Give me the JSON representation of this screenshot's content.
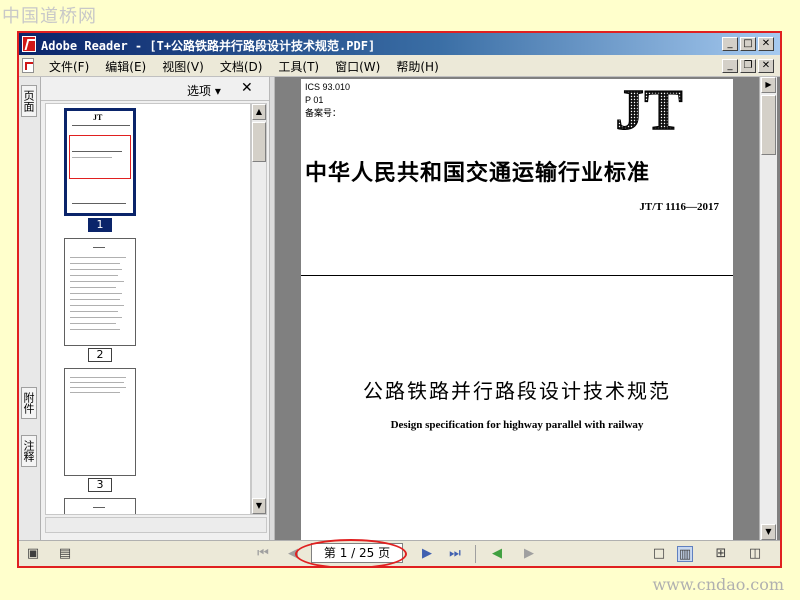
{
  "watermark": {
    "top": "中国道桥网",
    "bottom": "www.cndao.com"
  },
  "window": {
    "title": "Adobe Reader - [T+公路铁路并行路段设计技术规范.PDF]",
    "controls": {
      "minimize": "_",
      "maximize": "□",
      "close": "✕"
    },
    "doc_controls": {
      "minimize": "_",
      "restore": "❐",
      "close": "✕"
    }
  },
  "menu": [
    "文件(F)",
    "编辑(E)",
    "视图(V)",
    "文档(D)",
    "工具(T)",
    "窗口(W)",
    "帮助(H)"
  ],
  "tabs": {
    "pages": "页面",
    "attachments": "附件",
    "comments": "注释"
  },
  "panel": {
    "options_label": "选项 ▾",
    "close": "✕",
    "thumbnails": [
      {
        "num": "1",
        "selected": true
      },
      {
        "num": "2",
        "selected": false
      },
      {
        "num": "3",
        "selected": false
      }
    ]
  },
  "document": {
    "ics": "ICS 93.010",
    "p": "P 01",
    "record": "备案号：",
    "logo": "JT",
    "standard_title": "中华人民共和国交通运输行业标准",
    "standard_code": "JT/T 1116—2017",
    "main_title": "公路铁路并行路段设计技术规范",
    "english_title": "Design specification for highway parallel with railway"
  },
  "status": {
    "page_indicator": "第 1 / 25 页"
  },
  "colors": {
    "title_bar": "#0a246a",
    "highlight_red": "#e02020",
    "selection": "#0a246a"
  }
}
